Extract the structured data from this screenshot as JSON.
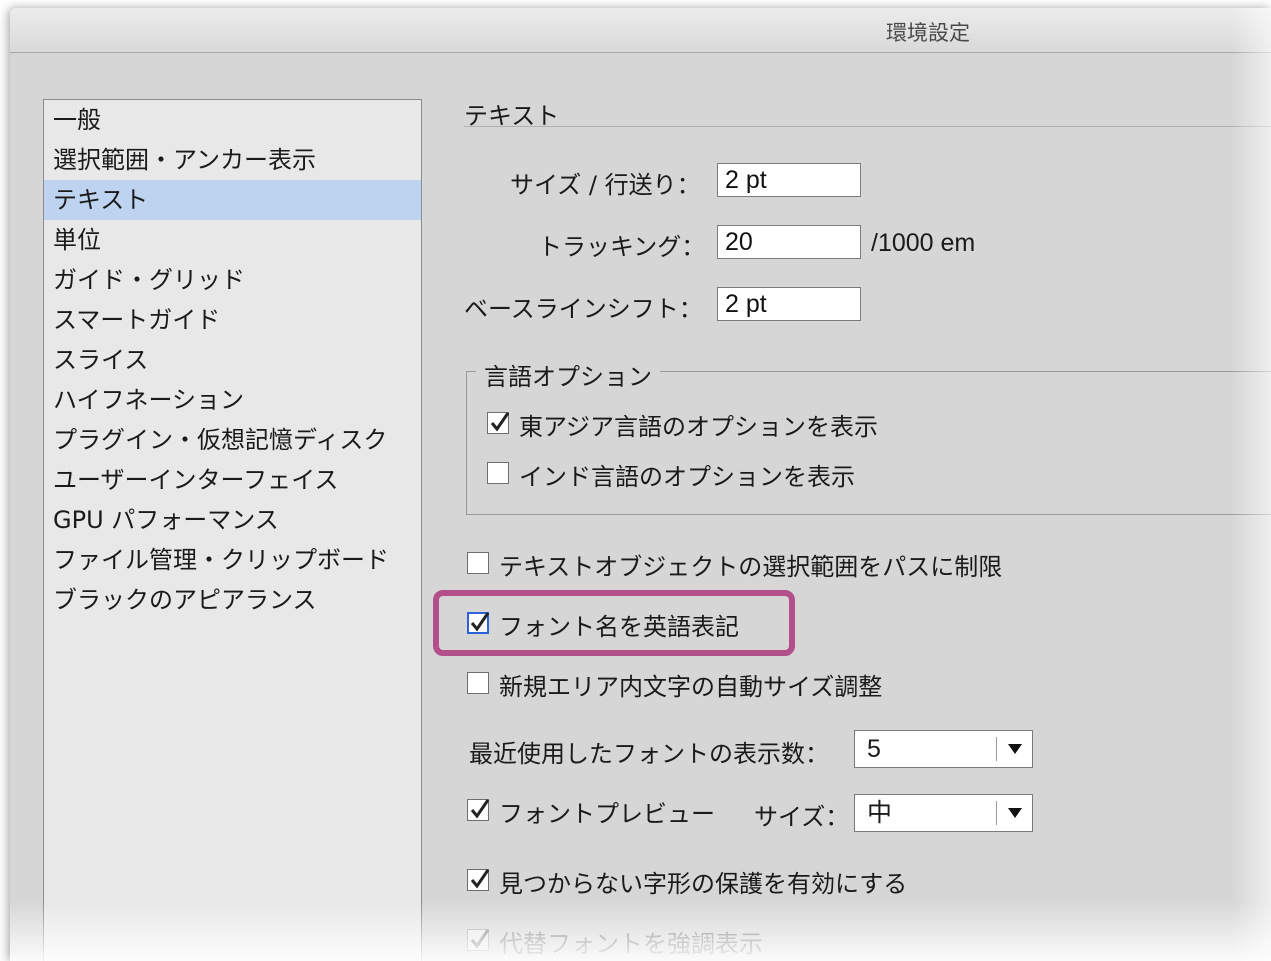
{
  "window": {
    "title": "環境設定"
  },
  "sidebar": {
    "items": [
      {
        "label": "一般"
      },
      {
        "label": "選択範囲・アンカー表示"
      },
      {
        "label": "テキスト"
      },
      {
        "label": "単位"
      },
      {
        "label": "ガイド・グリッド"
      },
      {
        "label": "スマートガイド"
      },
      {
        "label": "スライス"
      },
      {
        "label": "ハイフネーション"
      },
      {
        "label": "プラグイン・仮想記憶ディスク"
      },
      {
        "label": "ユーザーインターフェイス"
      },
      {
        "label": "GPU パフォーマンス"
      },
      {
        "label": "ファイル管理・クリップボード"
      },
      {
        "label": "ブラックのアピアランス"
      }
    ],
    "selected": "テキスト"
  },
  "text_panel": {
    "section_title": "テキスト",
    "size_leading": {
      "label": "サイズ / 行送り：",
      "value": "2 pt"
    },
    "tracking": {
      "label": "トラッキング：",
      "value": "20",
      "unit": "/1000 em"
    },
    "baseline_shift": {
      "label": "ベースラインシフト：",
      "value": "2 pt"
    },
    "language_options": {
      "legend": "言語オプション",
      "east_asian": {
        "label": "東アジア言語のオプションを表示",
        "checked": true
      },
      "indic": {
        "label": "インド言語のオプションを表示",
        "checked": false
      }
    },
    "restrict_selection": {
      "label": "テキストオブジェクトの選択範囲をパスに制限",
      "checked": false
    },
    "font_names_english": {
      "label": "フォント名を英語表記",
      "checked": true
    },
    "auto_size_area": {
      "label": "新規エリア内文字の自動サイズ調整",
      "checked": false
    },
    "recent_fonts": {
      "label": "最近使用したフォントの表示数：",
      "value": "5"
    },
    "font_preview": {
      "label": "フォントプレビュー",
      "checked": true,
      "size_label": "サイズ：",
      "size_value": "中"
    },
    "protect_glyphs": {
      "label": "見つからない字形の保護を有効にする",
      "checked": true
    },
    "highlight_substituted": {
      "label": "代替フォントを強調表示",
      "checked": true
    }
  },
  "colors": {
    "accent_highlight": "#b3508c",
    "selection": "#bdd3ef",
    "focus": "#2c63d8"
  }
}
